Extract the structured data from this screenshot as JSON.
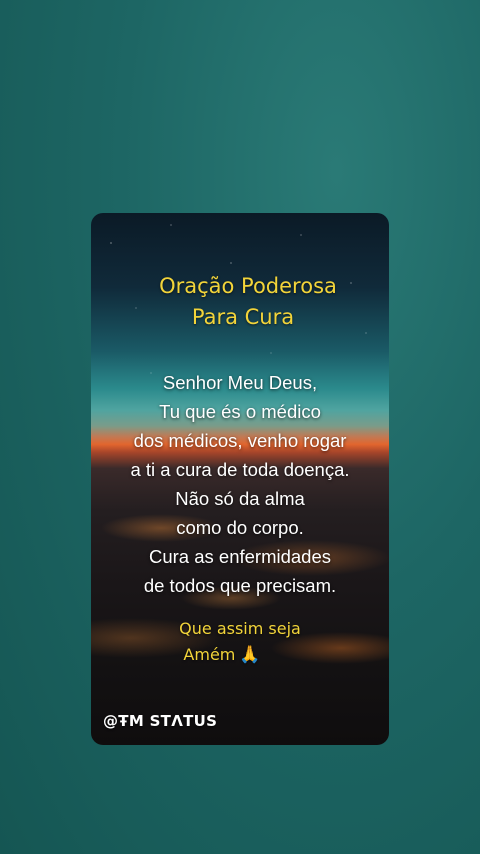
{
  "card": {
    "title_line1": "Oração Poderosa",
    "title_line2": "Para Cura",
    "prayer_lines": [
      "Senhor Meu Deus,",
      "Tu que és o médico",
      "dos médicos, venho rogar",
      "a ti a cura de toda doença.",
      "Não só da alma",
      "como do corpo.",
      "Cura as enfermidades",
      "de todos que precisam."
    ],
    "closing_line1": "Que assim seja",
    "closing_line2": "Amém",
    "closing_icon": "praying-hands-icon",
    "watermark": "@ŦM STΛTUS"
  },
  "colors": {
    "background": "#1d6664",
    "title": "#f2d43a",
    "prayer_text": "#ffffff"
  }
}
